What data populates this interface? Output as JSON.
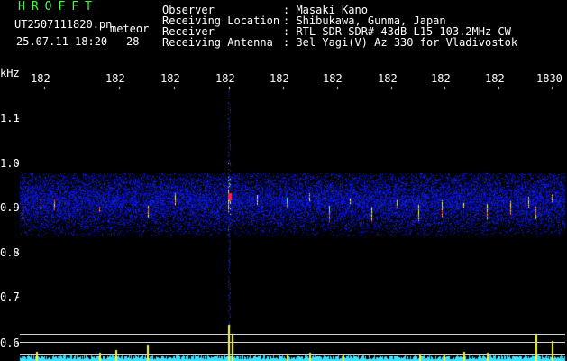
{
  "header": {
    "station_code": "HROFFT",
    "filename": "UT2507111820.pn",
    "meteor_label": "meteor",
    "datetime": "25.07.11 18:20",
    "meteor_count": "28",
    "info_labels": [
      "Observer",
      "Receiving Location",
      "Receiver",
      "Receiving Antenna"
    ],
    "info_values": [
      ": Masaki Kano",
      ": Shibukawa, Gunma, Japan",
      ": RTL-SDR SDR# 43dB L15 103.2MHz CW",
      ": 3el Yagi(V) Az 330 for Vladivostok"
    ]
  },
  "time_axis": {
    "unit": "",
    "tick_labels": [
      "182",
      "182",
      "182",
      "182",
      "182",
      "182",
      "182",
      "182",
      "182",
      "1830"
    ]
  },
  "freq_axis": {
    "unit": "kHz",
    "tick_labels": [
      "1.1",
      "1.0",
      "0.9",
      "0.8",
      "0.7",
      "0.6"
    ]
  },
  "colors": {
    "background": "#000000",
    "header_green": "#3cff3c",
    "text_white": "#ffffff",
    "noise_blue": "#1a2cff",
    "meteor_red": "#ff2040",
    "meteor_yellow": "#ffff3c",
    "meteor_cyan": "#40ffff",
    "bottom_trace_cyan": "#40e0ff",
    "bottom_trace_yellow": "#ffff30"
  }
}
